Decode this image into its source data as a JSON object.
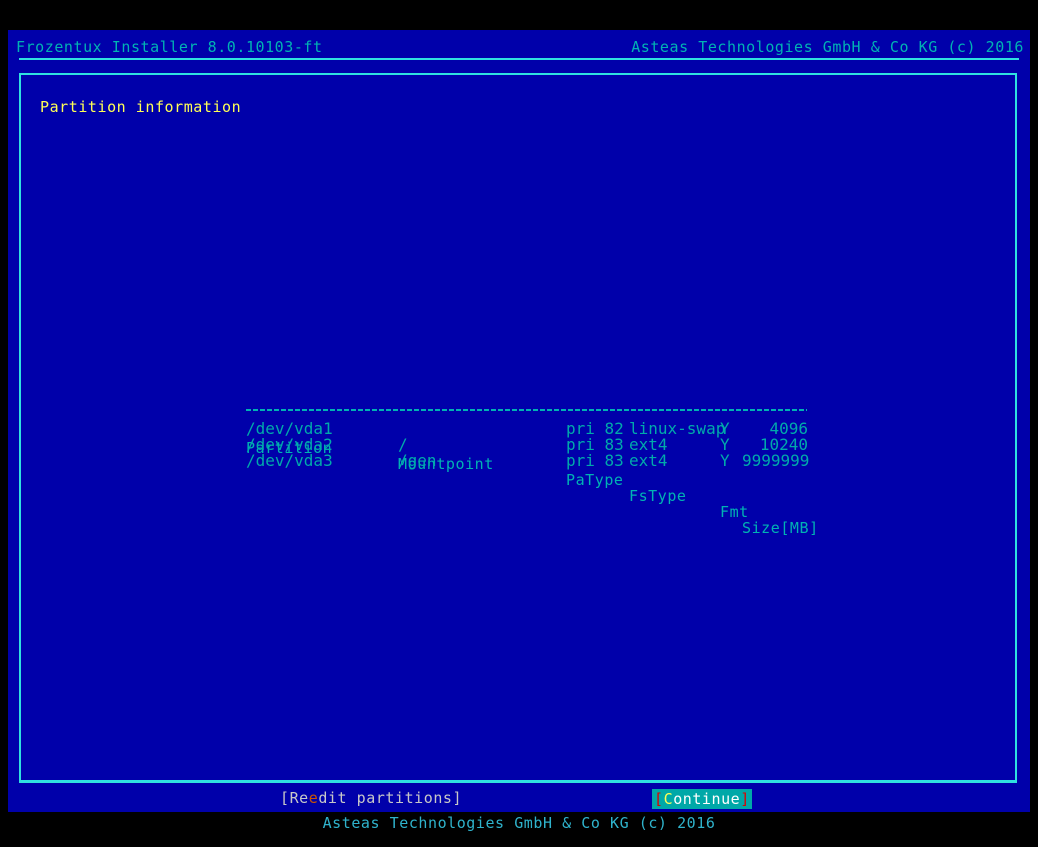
{
  "header": {
    "app_title": "Frozentux Installer 8.0.10103-ft",
    "corporate": "Asteas Technologies GmbH & Co KG (c) 2016"
  },
  "frame": {
    "legend": "Partition information"
  },
  "table": {
    "columns": {
      "partition": "Partition",
      "mountpoint": "Mountpoint",
      "patype": "PaType",
      "fstype": "FsType",
      "fmt": "Fmt",
      "size": "Size[MB]"
    },
    "rows": [
      {
        "partition": "/dev/vda1",
        "mountpoint": "",
        "patype": "pri 82",
        "fstype": "linux-swap",
        "fmt": "Y",
        "size": "4096"
      },
      {
        "partition": "/dev/vda2",
        "mountpoint": "/",
        "patype": "pri 83",
        "fstype": "ext4",
        "fmt": "Y",
        "size": "10240"
      },
      {
        "partition": "/dev/vda3",
        "mountpoint": "/gen",
        "patype": "pri 83",
        "fstype": "ext4",
        "fmt": "Y",
        "size": "9999999"
      }
    ]
  },
  "buttons": {
    "reedit": {
      "prefix": "[Re",
      "hotkey": "e",
      "suffix": "dit partitions]"
    },
    "continue": {
      "open_bracket": "[",
      "hotkey": "C",
      "rest": "ontinue",
      "close_bracket": "]",
      "selected": true
    }
  },
  "footer": {
    "text": "Asteas Technologies GmbH & Co KG (c) 2016"
  },
  "colors": {
    "background": "#0000aa",
    "border": "#2fe0e0",
    "text": "#00b3b3",
    "legend": "#ffff55",
    "button_text": "#c8c8c8",
    "hotkey": "#cc5500",
    "selected_bg": "#00a8a8",
    "selected_bracket": "#dd0000",
    "selected_hotkey": "#ffff55",
    "outer": "#000000"
  }
}
